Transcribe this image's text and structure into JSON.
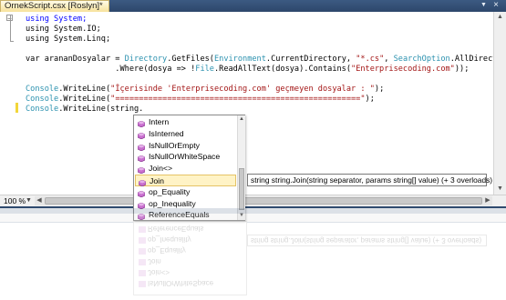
{
  "window": {
    "tab_title": "OrnekScript.csx [Roslyn]*",
    "dropdown_glyph": "▼",
    "close_glyph": "×"
  },
  "code": {
    "l1": "using System;",
    "l2": "using System.IO;",
    "l3": "using System.Linq;",
    "l5a": "var arananDosyalar = ",
    "l5b": "Directory",
    "l5c": ".GetFiles(",
    "l5d": "Environment",
    "l5e": ".CurrentDirectory, ",
    "l5f": "\"*.cs\"",
    "l5g": ", ",
    "l5h": "SearchOption",
    "l5i": ".AllDirectories)",
    "l6a": "                   .Where(dosya => !",
    "l6b": "File",
    "l6c": ".ReadAllText(dosya).Contains(",
    "l6d": "\"Enterprisecoding.com\"",
    "l6e": "));",
    "l8a": "Console",
    "l8b": ".WriteLine(",
    "l8c": "\"İçerisinde 'Enterprisecoding.com' geçmeyen dosyalar : \"",
    "l8d": ");",
    "l9a": "Console",
    "l9b": ".WriteLine(",
    "l9c": "\"====================================================\"",
    "l9d": ");",
    "l10a": "Console",
    "l10b": ".WriteLine(string."
  },
  "completion": {
    "items": [
      {
        "label": "Intern"
      },
      {
        "label": "IsInterned"
      },
      {
        "label": "IsNullOrEmpty"
      },
      {
        "label": "IsNullOrWhiteSpace"
      },
      {
        "label": "Join<>"
      },
      {
        "label": "Join"
      },
      {
        "label": "op_Equality"
      },
      {
        "label": "op_Inequality"
      },
      {
        "label": "ReferenceEquals"
      }
    ],
    "selected_index": 5,
    "tooltip": "string string.Join(string separator, params string[] value) (+ 3 overloads)"
  },
  "status": {
    "zoom": "100 %"
  },
  "colors": {
    "keyword": "#0000ff",
    "type": "#2b91af",
    "string": "#a31515",
    "frame": "#2f4a6e",
    "selected_item": "#fff3c6",
    "method_icon": "#c86fce"
  },
  "icons": {
    "method": "method-icon",
    "collapse": "collapse-minus-icon"
  }
}
